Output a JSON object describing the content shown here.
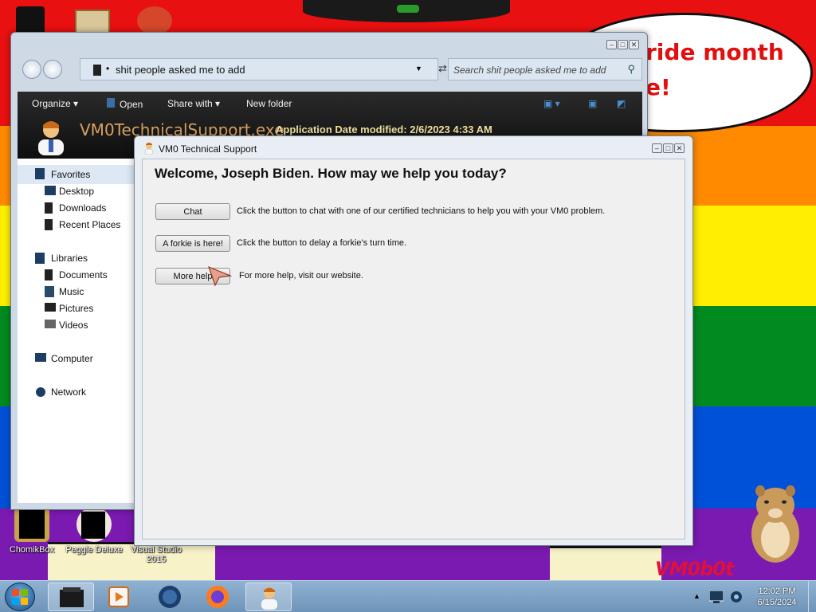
{
  "desktop": {
    "banner_line1": "ride month",
    "banner_line2": "e!",
    "logo": "VM0b0t",
    "icons": [
      {
        "label": "ChomikBox"
      },
      {
        "label": "Peggle Deluxe"
      },
      {
        "label": "Visual Studio 2015"
      }
    ]
  },
  "explorer": {
    "address": "shit people asked me to add",
    "search_placeholder": "Search shit people asked me to add",
    "toolbar": {
      "organize": "Organize",
      "open": "Open",
      "share_with": "Share with",
      "new_folder": "New folder"
    },
    "file_name": "VM0TechnicalSupport.exe",
    "file_meta": "Application  Date modified: 2/6/2023 4:33 AM",
    "sidebar": {
      "favorites": "Favorites",
      "desktop": "Desktop",
      "downloads": "Downloads",
      "recent_places": "Recent Places",
      "libraries": "Libraries",
      "documents": "Documents",
      "music": "Music",
      "pictures": "Pictures",
      "videos": "Videos",
      "computer": "Computer",
      "network": "Network"
    }
  },
  "dialog": {
    "title": "VM0 Technical Support",
    "welcome": "Welcome, Joseph Biden. How may we help you today?",
    "chat_label": "Chat",
    "chat_desc": "Click the button to chat with one of our certified technicians to help you with your VM0 problem.",
    "forkie_label": "A forkie is here!",
    "forkie_desc": "Click the button to delay a forkie's turn time.",
    "more_label": "More help",
    "more_desc": "For more help, visit our website."
  },
  "taskbar": {
    "time": "12:02 PM",
    "date": "6/15/2024"
  },
  "colors": {
    "red": "#e81010",
    "orange": "#ff8a00",
    "yellow": "#ffee00",
    "green": "#008a20",
    "blue": "#0050d8",
    "purple": "#7a1ab0"
  }
}
